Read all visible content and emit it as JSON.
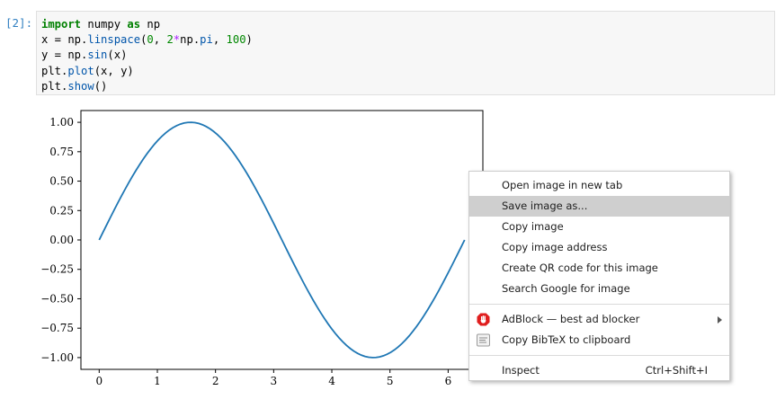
{
  "cell": {
    "prompt": "[2]:",
    "code_lines": [
      [
        {
          "t": "import",
          "c": "kw"
        },
        {
          "t": " numpy ",
          "c": ""
        },
        {
          "t": "as",
          "c": "kw"
        },
        {
          "t": " np",
          "c": ""
        }
      ],
      [
        {
          "t": "x = np.",
          "c": ""
        },
        {
          "t": "linspace",
          "c": "fn"
        },
        {
          "t": "(",
          "c": ""
        },
        {
          "t": "0",
          "c": "num"
        },
        {
          "t": ", ",
          "c": ""
        },
        {
          "t": "2",
          "c": "num"
        },
        {
          "t": "*",
          "c": "op"
        },
        {
          "t": "np.",
          "c": ""
        },
        {
          "t": "pi",
          "c": "fn"
        },
        {
          "t": ", ",
          "c": ""
        },
        {
          "t": "100",
          "c": "num"
        },
        {
          "t": ")",
          "c": ""
        }
      ],
      [
        {
          "t": "y = np.",
          "c": ""
        },
        {
          "t": "sin",
          "c": "fn"
        },
        {
          "t": "(x)",
          "c": ""
        }
      ],
      [
        {
          "t": "plt.",
          "c": ""
        },
        {
          "t": "plot",
          "c": "fn"
        },
        {
          "t": "(x, y)",
          "c": ""
        }
      ],
      [
        {
          "t": "plt.",
          "c": ""
        },
        {
          "t": "show",
          "c": "fn"
        },
        {
          "t": "()",
          "c": ""
        }
      ]
    ]
  },
  "chart_data": {
    "type": "line",
    "function": "sin(x)",
    "x_range": [
      0,
      6.283185307179586
    ],
    "num_points": 100,
    "xlim": [
      -0.314,
      6.597
    ],
    "ylim": [
      -1.1,
      1.1
    ],
    "xticks": [
      0,
      1,
      2,
      3,
      4,
      5,
      6
    ],
    "xtick_labels": [
      "0",
      "1",
      "2",
      "3",
      "4",
      "5",
      "6"
    ],
    "yticks": [
      1.0,
      0.75,
      0.5,
      0.25,
      0.0,
      -0.25,
      -0.5,
      -0.75,
      -1.0
    ],
    "ytick_labels": [
      "1.00",
      "0.75",
      "0.50",
      "0.25",
      "0.00",
      "−0.25",
      "−0.50",
      "−0.75",
      "−1.00"
    ],
    "series": [
      {
        "color": "#1f77b4"
      }
    ],
    "grid": false
  },
  "context_menu": {
    "items": [
      {
        "label": "Open image in new tab",
        "name": "menu-open-image-new-tab"
      },
      {
        "label": "Save image as...",
        "name": "menu-save-image-as",
        "highlighted": true
      },
      {
        "label": "Copy image",
        "name": "menu-copy-image"
      },
      {
        "label": "Copy image address",
        "name": "menu-copy-image-address"
      },
      {
        "label": "Create QR code for this image",
        "name": "menu-create-qr-code"
      },
      {
        "label": "Search Google for image",
        "name": "menu-search-google-image"
      },
      {
        "separator": true
      },
      {
        "label": "AdBlock — best ad blocker",
        "name": "menu-adblock",
        "icon": "adblock-hand-icon",
        "submenu": true
      },
      {
        "label": "Copy BibTeX to clipboard",
        "name": "menu-copy-bibtex",
        "icon": "bibtex-icon"
      },
      {
        "separator": true
      },
      {
        "label": "Inspect",
        "name": "menu-inspect",
        "shortcut": "Ctrl+Shift+I"
      }
    ]
  },
  "colors": {
    "line": "#1f77b4",
    "prompt": "#307fc1",
    "menu_highlight": "#cfcfcf",
    "adblock_red": "#e01e1e"
  }
}
